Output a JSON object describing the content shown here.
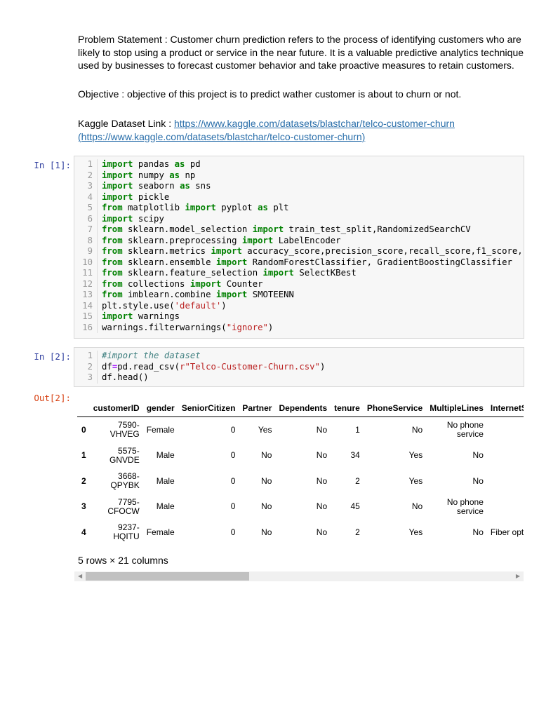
{
  "markdown": {
    "problem_statement": "Problem Statement : Customer churn prediction refers to the process of identifying customers who are likely to stop using a product or service in the near future. It is a valuable predictive analytics technique used by businesses to forecast customer behavior and take proactive measures to retain customers.",
    "objective": "Objective : objective of this project is to predict wather customer is about to churn or not.",
    "dataset_label": "Kaggle Dataset Link : ",
    "dataset_link": "https://www.kaggle.com/datasets/blastchar/telco-customer-churn",
    "dataset_link_paren": "(https://www.kaggle.com/datasets/blastchar/telco-customer-churn)"
  },
  "cells": [
    {
      "prompt": "In [1]:",
      "lines": [
        "import pandas as pd",
        "import numpy as np",
        "import seaborn as sns",
        "import pickle",
        "from matplotlib import pyplot as plt",
        "import scipy",
        "from sklearn.model_selection import train_test_split,RandomizedSearchCV",
        "from sklearn.preprocessing import LabelEncoder",
        "from sklearn.metrics import accuracy_score,precision_score,recall_score,f1_score,",
        "from sklearn.ensemble import RandomForestClassifier, GradientBoostingClassifier",
        "from sklearn.feature_selection import SelectKBest",
        "from collections import Counter",
        "from imblearn.combine import SMOTEENN",
        "plt.style.use('default')",
        "import warnings",
        "warnings.filterwarnings(\"ignore\")"
      ]
    },
    {
      "prompt": "In [2]:",
      "lines": [
        "#import the dataset",
        "df=pd.read_csv(r\"Telco-Customer-Churn.csv\")",
        "df.head()"
      ]
    }
  ],
  "output": {
    "prompt": "Out[2]:",
    "columns": [
      "",
      "customerID",
      "gender",
      "SeniorCitizen",
      "Partner",
      "Dependents",
      "tenure",
      "PhoneService",
      "MultipleLines",
      "InternetService"
    ],
    "rows": [
      [
        "0",
        "7590-VHVEG",
        "Female",
        "0",
        "Yes",
        "No",
        "1",
        "No",
        "No phone service",
        ""
      ],
      [
        "1",
        "5575-GNVDE",
        "Male",
        "0",
        "No",
        "No",
        "34",
        "Yes",
        "No",
        ""
      ],
      [
        "2",
        "3668-QPYBK",
        "Male",
        "0",
        "No",
        "No",
        "2",
        "Yes",
        "No",
        ""
      ],
      [
        "3",
        "7795-CFOCW",
        "Male",
        "0",
        "No",
        "No",
        "45",
        "No",
        "No phone service",
        ""
      ],
      [
        "4",
        "9237-HQITU",
        "Female",
        "0",
        "No",
        "No",
        "2",
        "Yes",
        "No",
        "Fiber optic"
      ]
    ],
    "shape": "5 rows × 21 columns"
  }
}
